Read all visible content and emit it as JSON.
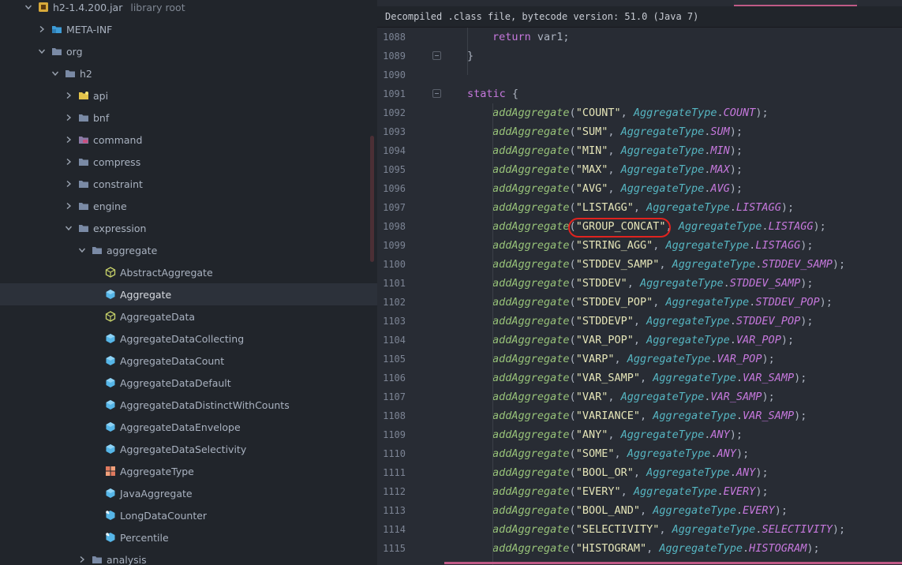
{
  "tree": {
    "rows": [
      {
        "label": "h2-1.4.200.jar",
        "suffix": "library root",
        "depth": 0,
        "expanded": true,
        "icon": "jar-icon"
      },
      {
        "label": "META-INF",
        "depth": 1,
        "expanded": false,
        "icon": "meta-folder-icon"
      },
      {
        "label": "org",
        "depth": 1,
        "expanded": true,
        "icon": "folder-icon"
      },
      {
        "label": "h2",
        "depth": 2,
        "expanded": true,
        "icon": "folder-icon"
      },
      {
        "label": "api",
        "depth": 3,
        "expanded": false,
        "icon": "api-folder-icon"
      },
      {
        "label": "bnf",
        "depth": 3,
        "expanded": false,
        "icon": "folder-icon"
      },
      {
        "label": "command",
        "depth": 3,
        "expanded": false,
        "icon": "command-folder-icon"
      },
      {
        "label": "compress",
        "depth": 3,
        "expanded": false,
        "icon": "folder-icon"
      },
      {
        "label": "constraint",
        "depth": 3,
        "expanded": false,
        "icon": "folder-icon"
      },
      {
        "label": "engine",
        "depth": 3,
        "expanded": false,
        "icon": "folder-icon"
      },
      {
        "label": "expression",
        "depth": 3,
        "expanded": true,
        "icon": "folder-icon"
      },
      {
        "label": "aggregate",
        "depth": 4,
        "expanded": true,
        "icon": "folder-icon"
      },
      {
        "label": "AbstractAggregate",
        "depth": 5,
        "icon": "abstract-class-icon"
      },
      {
        "label": "Aggregate",
        "depth": 5,
        "icon": "class-icon",
        "selected": true
      },
      {
        "label": "AggregateData",
        "depth": 5,
        "icon": "abstract-class-icon"
      },
      {
        "label": "AggregateDataCollecting",
        "depth": 5,
        "icon": "class-icon"
      },
      {
        "label": "AggregateDataCount",
        "depth": 5,
        "icon": "class-icon"
      },
      {
        "label": "AggregateDataDefault",
        "depth": 5,
        "icon": "class-icon"
      },
      {
        "label": "AggregateDataDistinctWithCounts",
        "depth": 5,
        "icon": "class-icon"
      },
      {
        "label": "AggregateDataEnvelope",
        "depth": 5,
        "icon": "class-icon"
      },
      {
        "label": "AggregateDataSelectivity",
        "depth": 5,
        "icon": "class-icon"
      },
      {
        "label": "AggregateType",
        "depth": 5,
        "icon": "enum-icon"
      },
      {
        "label": "JavaAggregate",
        "depth": 5,
        "icon": "class-icon"
      },
      {
        "label": "LongDataCounter",
        "depth": 5,
        "icon": "inner-class-icon"
      },
      {
        "label": "Percentile",
        "depth": 5,
        "icon": "inner-class-icon"
      },
      {
        "label": "analysis",
        "depth": 4,
        "expanded": false,
        "icon": "folder-icon"
      }
    ]
  },
  "editor": {
    "banner": "Decompiled .class file, bytecode version: 51.0 (Java 7)",
    "lines": [
      {
        "n": "1088",
        "tokens": [
          [
            "kw",
            "return"
          ],
          [
            "pun",
            " var1;"
          ]
        ],
        "indent": 2
      },
      {
        "n": "1089",
        "tokens": [
          [
            "pun",
            "}"
          ]
        ],
        "indent": 1,
        "fold": true
      },
      {
        "n": "1090",
        "tokens": [],
        "indent": 1
      },
      {
        "n": "1091",
        "tokens": [
          [
            "kw",
            "static"
          ],
          [
            "pun",
            " {"
          ]
        ],
        "indent": 1,
        "fold": true
      },
      {
        "n": "1092",
        "agg": [
          "COUNT",
          "COUNT"
        ]
      },
      {
        "n": "1093",
        "agg": [
          "SUM",
          "SUM"
        ]
      },
      {
        "n": "1094",
        "agg": [
          "MIN",
          "MIN"
        ]
      },
      {
        "n": "1095",
        "agg": [
          "MAX",
          "MAX"
        ]
      },
      {
        "n": "1096",
        "agg": [
          "AVG",
          "AVG"
        ]
      },
      {
        "n": "1097",
        "agg": [
          "LISTAGG",
          "LISTAGG"
        ]
      },
      {
        "n": "1098",
        "agg": [
          "GROUP_CONCAT",
          "LISTAGG"
        ]
      },
      {
        "n": "1099",
        "agg": [
          "STRING_AGG",
          "LISTAGG"
        ]
      },
      {
        "n": "1100",
        "agg": [
          "STDDEV_SAMP",
          "STDDEV_SAMP"
        ]
      },
      {
        "n": "1101",
        "agg": [
          "STDDEV",
          "STDDEV_SAMP"
        ]
      },
      {
        "n": "1102",
        "agg": [
          "STDDEV_POP",
          "STDDEV_POP"
        ]
      },
      {
        "n": "1103",
        "agg": [
          "STDDEVP",
          "STDDEV_POP"
        ]
      },
      {
        "n": "1104",
        "agg": [
          "VAR_POP",
          "VAR_POP"
        ]
      },
      {
        "n": "1105",
        "agg": [
          "VARP",
          "VAR_POP"
        ]
      },
      {
        "n": "1106",
        "agg": [
          "VAR_SAMP",
          "VAR_SAMP"
        ]
      },
      {
        "n": "1107",
        "agg": [
          "VAR",
          "VAR_SAMP"
        ]
      },
      {
        "n": "1108",
        "agg": [
          "VARIANCE",
          "VAR_SAMP"
        ]
      },
      {
        "n": "1109",
        "agg": [
          "ANY",
          "ANY"
        ]
      },
      {
        "n": "1110",
        "agg": [
          "SOME",
          "ANY"
        ]
      },
      {
        "n": "1111",
        "agg": [
          "BOOL_OR",
          "ANY"
        ]
      },
      {
        "n": "1112",
        "agg": [
          "EVERY",
          "EVERY"
        ]
      },
      {
        "n": "1113",
        "agg": [
          "BOOL_AND",
          "EVERY"
        ]
      },
      {
        "n": "1114",
        "agg": [
          "SELECTIVITY",
          "SELECTIVITY"
        ]
      },
      {
        "n": "1115",
        "agg": [
          "HISTOGRAM",
          "HISTOGRAM"
        ]
      }
    ],
    "call_name": "addAggregate",
    "type_name": "AggregateType",
    "highlighted_string": "GROUP_CONCAT"
  },
  "colors": {
    "keyword": "#c678dd",
    "function": "#98c379",
    "string": "#e5e5b8",
    "class": "#56b6c2",
    "constant": "#c678dd",
    "highlight_oval": "#e0231f"
  }
}
